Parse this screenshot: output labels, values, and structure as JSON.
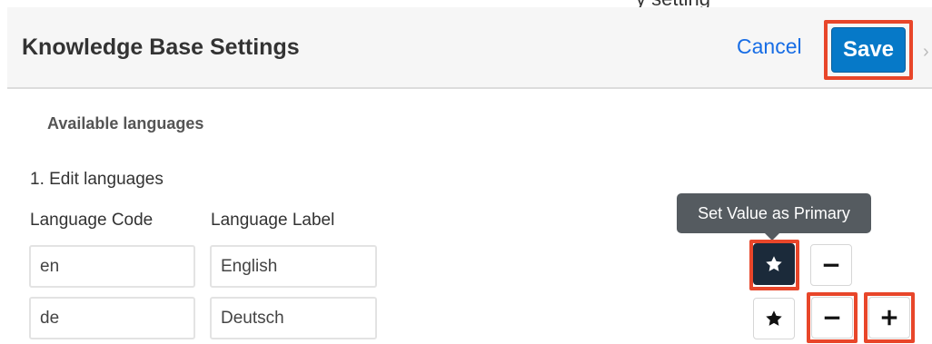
{
  "page_heading_fragment": "y setting",
  "header": {
    "title": "Knowledge Base Settings",
    "cancel_label": "Cancel",
    "save_label": "Save"
  },
  "form": {
    "section_title": "Available languages",
    "step_title": "1. Edit languages",
    "columns": {
      "code": "Language Code",
      "label": "Language Label"
    },
    "rows": [
      {
        "code": "en",
        "label": "English",
        "primary": true
      },
      {
        "code": "de",
        "label": "Deutsch",
        "primary": false
      }
    ]
  },
  "tooltip": "Set Value as Primary",
  "icons": {
    "primary": "star-icon",
    "remove": "minus-icon",
    "add": "plus-icon"
  },
  "colors": {
    "accent": "#0679c8",
    "link": "#176de5",
    "highlight": "#e8462a",
    "primary_button": "#1b2a3a"
  }
}
